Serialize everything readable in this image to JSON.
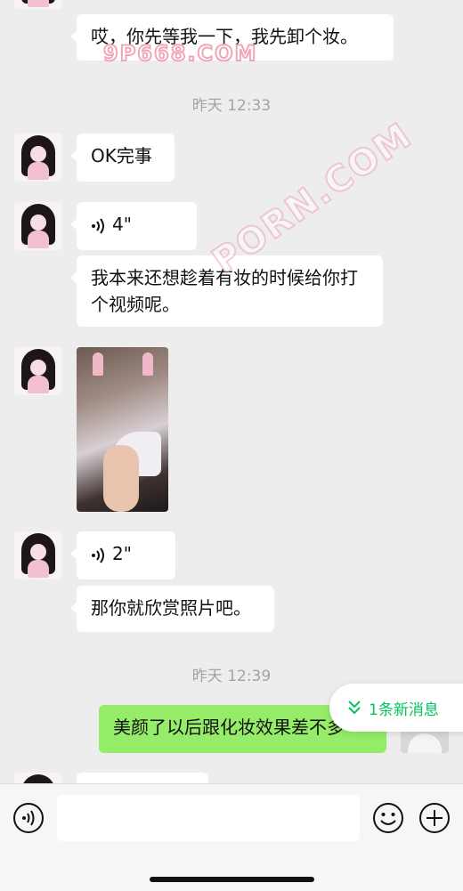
{
  "messages": {
    "m1": "哎，你先等我一下，我先卸个妆。",
    "t1": "昨天 12:33",
    "m2": "OK完事",
    "v1": "4\"",
    "m3": "我本来还想趁着有妆的时候给你打个视频呢。",
    "v2": "2\"",
    "m4": "那你就欣赏照片吧。",
    "t2": "昨天 12:39",
    "m5": "美颜了以后跟化妆效果差不多"
  },
  "new_messages_label": "1条新消息",
  "watermarks": {
    "top": "9P668.COM",
    "diagonal": "PORN.COM"
  },
  "input": {
    "value": "",
    "placeholder": ""
  },
  "icons": {
    "voice": "voice-wave-icon",
    "emoji": "emoji-icon",
    "plus": "plus-icon",
    "mic": "voice-input-icon",
    "chevron": "double-chevron-down-icon"
  },
  "colors": {
    "background": "#ededed",
    "bubble_in": "#ffffff",
    "bubble_out": "#95ec69",
    "accent": "#07c160",
    "timestamp": "#a3a3a3"
  }
}
